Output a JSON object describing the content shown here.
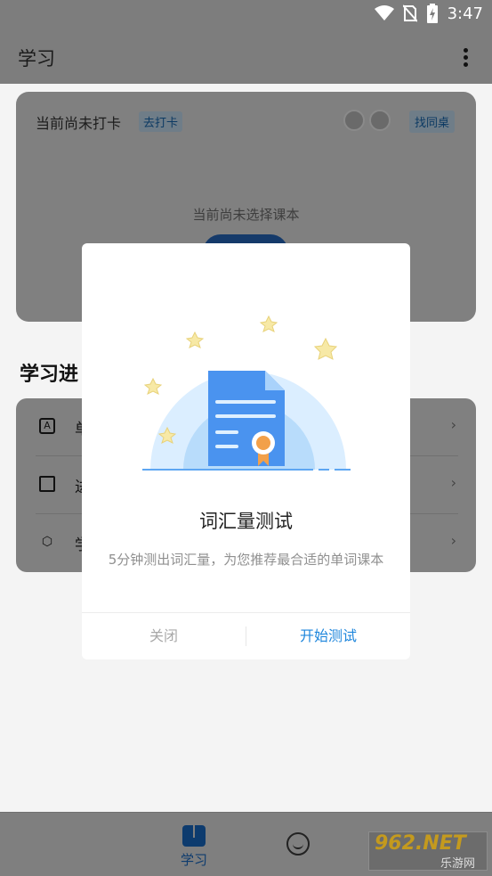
{
  "status_bar": {
    "time": "3:47",
    "icons": [
      "wifi-icon",
      "no-sim-icon",
      "battery-charging-icon"
    ]
  },
  "app_bar": {
    "title": "学习",
    "menu_icon": "more-vert-icon"
  },
  "checkin_card": {
    "status": "当前尚未打卡",
    "checkin_link": "去打卡",
    "partner_button": "找同桌",
    "no_book_text": "当前尚未选择课本"
  },
  "progress": {
    "title": "学习进",
    "items": [
      {
        "icon": "a-icon",
        "label": "单"
      },
      {
        "icon": "ticket-icon",
        "label": "进"
      },
      {
        "icon": "hexagon-icon",
        "label": "学"
      }
    ]
  },
  "bottom_nav": {
    "items": [
      {
        "label": "学习",
        "icon": "book-icon",
        "active": true
      },
      {
        "label": "",
        "icon": "smile-icon",
        "active": false
      }
    ]
  },
  "watermark": {
    "top": "962.NET",
    "bottom": "乐游网"
  },
  "dialog": {
    "title": "词汇量测试",
    "description": "5分钟测出词汇量，为您推荐最合适的单词课本",
    "close_label": "关闭",
    "start_label": "开始测试",
    "illustration": "certificate-document-illustration"
  },
  "colors": {
    "accent": "#1e86dc",
    "overlay": "#7d7d7d",
    "dialog_bg": "#ffffff",
    "illus_circle": "#dbeeff",
    "doc_blue": "#4a93ef",
    "star": "#f7e9a6"
  }
}
